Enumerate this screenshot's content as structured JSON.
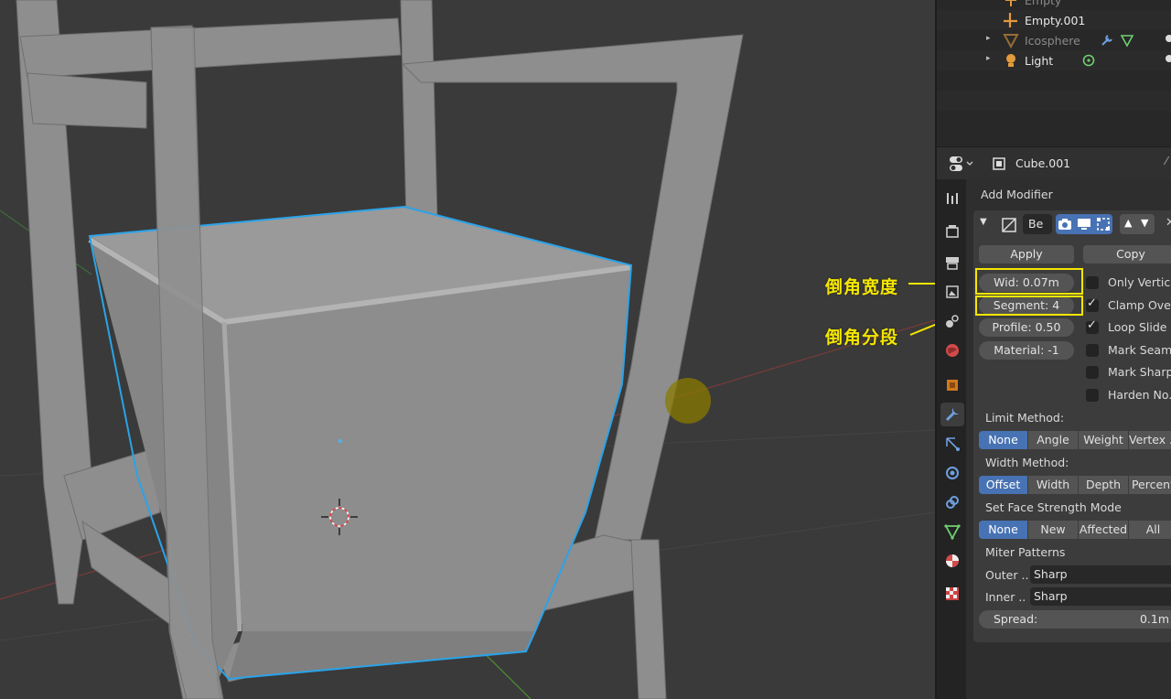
{
  "viewport": {
    "annotations": [
      {
        "text": "倒角宽度"
      },
      {
        "text": "倒角分段"
      }
    ],
    "colors": {
      "highlight": "#f4e600",
      "selection_outline": "#2ba3e8"
    }
  },
  "outliner": {
    "rows": [
      {
        "name": "Empty",
        "icon": "empty-icon"
      },
      {
        "name": "Empty.001",
        "icon": "empty-icon"
      },
      {
        "name": "Icosphere",
        "icon": "mesh-icon",
        "extras": [
          "wrench-icon",
          "vertex-group-icon"
        ]
      },
      {
        "name": "Light",
        "icon": "light-icon",
        "extras": [
          "light-data-icon"
        ]
      }
    ]
  },
  "properties": {
    "object_name": "Cube.001",
    "add_modifier": "Add Modifier",
    "modifier": {
      "name": "Be",
      "apply": "Apply",
      "copy": "Copy",
      "width": "Wid: 0.07m",
      "segments": "Segment: 4",
      "profile": "Profile:  0.50",
      "material": "Material:  -1",
      "checkboxes": [
        {
          "label": "Only Vertic...",
          "checked": false
        },
        {
          "label": "Clamp Ove...",
          "checked": true
        },
        {
          "label": "Loop Slide",
          "checked": true
        },
        {
          "label": "Mark Seams",
          "checked": false
        },
        {
          "label": "Mark Sharp",
          "checked": false
        },
        {
          "label": "Harden No...",
          "checked": false
        }
      ],
      "limit_method_label": "Limit Method:",
      "limit_method": [
        "None",
        "Angle",
        "Weight",
        "Vertex ..."
      ],
      "width_method_label": "Width Method:",
      "width_method": [
        "Offset",
        "Width",
        "Depth",
        "Percent"
      ],
      "face_strength_label": "Set Face Strength Mode",
      "face_strength": [
        "None",
        "New",
        "Affected",
        "All"
      ],
      "miter_label": "Miter Patterns",
      "outer_label": "Outer ..",
      "outer_value": "Sharp",
      "inner_label": "Inner ..",
      "inner_value": "Sharp",
      "spread_label": "Spread:",
      "spread_value": "0.1m"
    }
  }
}
